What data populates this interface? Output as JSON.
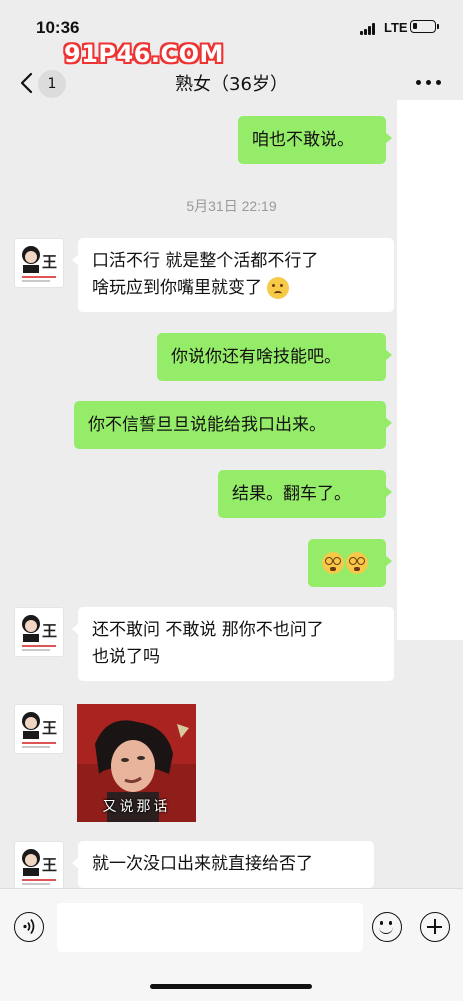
{
  "status_bar": {
    "time": "10:36",
    "network": "LTE",
    "battery_level": 0.15
  },
  "watermark": {
    "text": "91P46.COM"
  },
  "nav": {
    "back_count": "1",
    "title": "熟女（36岁）"
  },
  "messages": {
    "m1": "咱也不敢说。",
    "timestamp": "5月31日 22:19",
    "m2_line1": "口活不行 就是整个活都不行了",
    "m2_line2": "啥玩应到你嘴里就变了",
    "m3": "你说你还有啥技能吧。",
    "m4": "你不信誓旦旦说能给我口出来。",
    "m5": "结果。翻车了。",
    "m7_line1": "还不敢问 不敢说 那你不也问了",
    "m7_line2": "也说了吗",
    "meme_caption": "又说那话",
    "m9": "就一次没口出来就直接给否了"
  },
  "avatar": {
    "glyph": "王"
  },
  "icons": {
    "back": "chevron-left-icon",
    "more": "more-dots-icon",
    "voice": "voice-icon",
    "emoji": "emoji-icon",
    "plus": "plus-icon"
  },
  "colors": {
    "sent_bubble": "#95ec69",
    "received_bubble": "#ffffff",
    "background": "#ededed"
  }
}
